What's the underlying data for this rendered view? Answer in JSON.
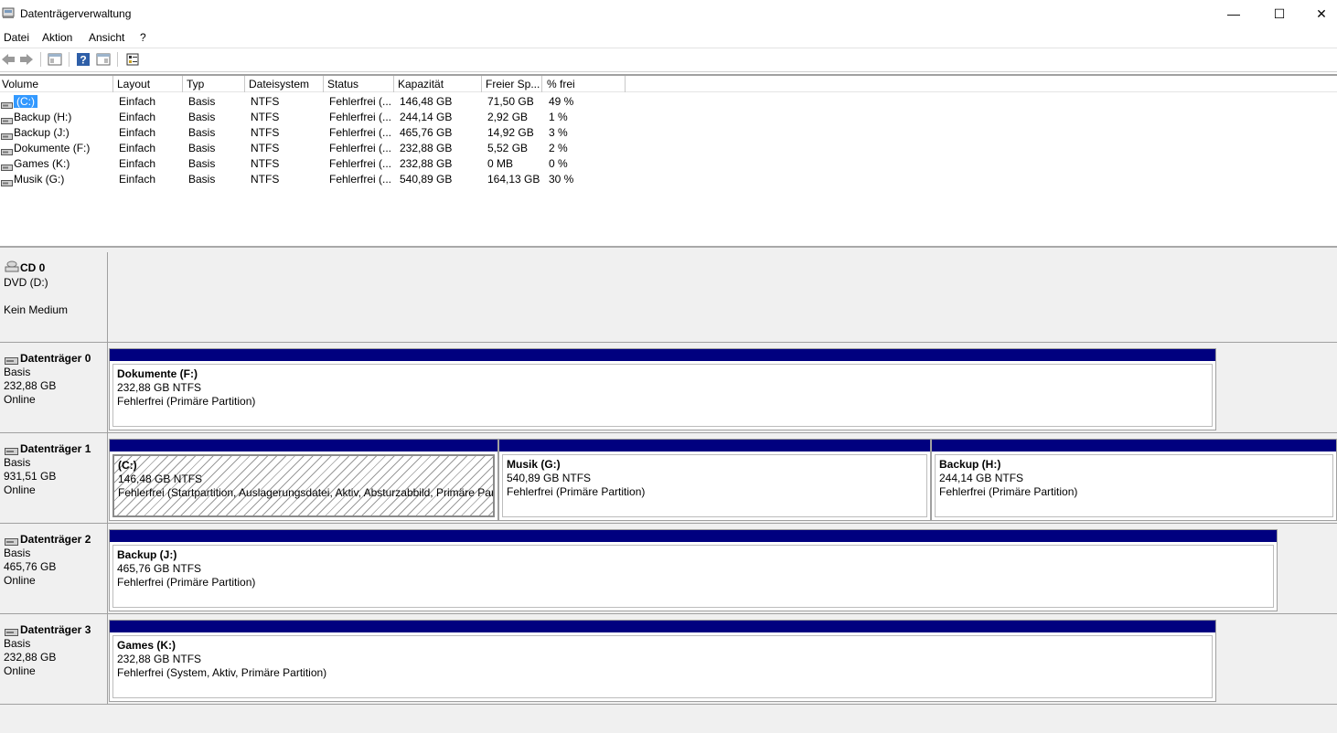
{
  "window": {
    "title": "Datenträgerverwaltung",
    "minimize": "—",
    "maximize": "☐",
    "close": "✕"
  },
  "menu": [
    "Datei",
    "Aktion",
    "Ansicht",
    "?"
  ],
  "toolbar": [
    "back-icon",
    "forward-icon",
    "console-tree-icon",
    "help-icon",
    "details-icon",
    "properties-icon"
  ],
  "volume_list": {
    "columns": [
      "Volume",
      "Layout",
      "Typ",
      "Dateisystem",
      "Status",
      "Kapazität",
      "Freier Sp...",
      "% frei"
    ],
    "rows": [
      [
        "(C:)",
        "Einfach",
        "Basis",
        "NTFS",
        "Fehlerfrei (...",
        "146,48 GB",
        "71,50 GB",
        "49 %"
      ],
      [
        "Backup (H:)",
        "Einfach",
        "Basis",
        "NTFS",
        "Fehlerfrei (...",
        "244,14 GB",
        "2,92 GB",
        "1 %"
      ],
      [
        "Backup (J:)",
        "Einfach",
        "Basis",
        "NTFS",
        "Fehlerfrei (...",
        "465,76 GB",
        "14,92 GB",
        "3 %"
      ],
      [
        "Dokumente (F:)",
        "Einfach",
        "Basis",
        "NTFS",
        "Fehlerfrei (...",
        "232,88 GB",
        "5,52 GB",
        "2 %"
      ],
      [
        "Games (K:)",
        "Einfach",
        "Basis",
        "NTFS",
        "Fehlerfrei (...",
        "232,88 GB",
        "0 MB",
        "0 %"
      ],
      [
        "Musik (G:)",
        "Einfach",
        "Basis",
        "NTFS",
        "Fehlerfrei (...",
        "540,89 GB",
        "164,13 GB",
        "30 %"
      ]
    ]
  },
  "disks": [
    {
      "name": "CD 0",
      "lines": [
        "DVD (D:)",
        "",
        "Kein Medium"
      ],
      "partitions": []
    },
    {
      "name": "Datenträger 0",
      "lines": [
        "Basis",
        "232,88 GB",
        "Online"
      ],
      "partitions": [
        {
          "name": "Dokumente  (F:)",
          "size": "232,88 GB NTFS",
          "status": "Fehlerfrei (Primäre Partition)"
        }
      ]
    },
    {
      "name": "Datenträger 1",
      "lines": [
        "Basis",
        "931,51 GB",
        "Online"
      ],
      "partitions": [
        {
          "name": "(C:)",
          "size": "146,48 GB NTFS",
          "status": "Fehlerfrei (Startpartition, Auslagerungsdatei, Aktiv, Absturzabbild, Primäre Partition)"
        },
        {
          "name": "Musik  (G:)",
          "size": "540,89 GB NTFS",
          "status": "Fehlerfrei (Primäre Partition)"
        },
        {
          "name": "Backup  (H:)",
          "size": "244,14 GB NTFS",
          "status": "Fehlerfrei (Primäre Partition)"
        }
      ]
    },
    {
      "name": "Datenträger 2",
      "lines": [
        "Basis",
        "465,76 GB",
        "Online"
      ],
      "partitions": [
        {
          "name": "Backup  (J:)",
          "size": "465,76 GB NTFS",
          "status": "Fehlerfrei (Primäre Partition)"
        }
      ]
    },
    {
      "name": "Datenträger 3",
      "lines": [
        "Basis",
        "232,88 GB",
        "Online"
      ],
      "partitions": [
        {
          "name": "Games  (K:)",
          "size": "232,88 GB NTFS",
          "status": "Fehlerfrei (System, Aktiv, Primäre Partition)"
        }
      ]
    }
  ],
  "colors": {
    "partition_bar": "#00007f",
    "selection": "#3399ff",
    "panel_bg": "#f0f0f0"
  }
}
